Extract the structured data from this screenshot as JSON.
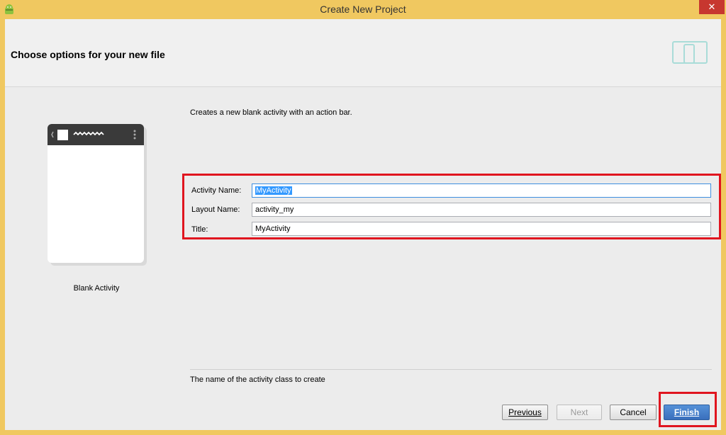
{
  "window": {
    "title": "Create New Project",
    "close_glyph": "✕"
  },
  "header": {
    "title": "Choose options for your new file",
    "icon": "device-preview-icon"
  },
  "template": {
    "name": "Blank Activity"
  },
  "description": "Creates a new blank activity with an action bar.",
  "form": {
    "fields": [
      {
        "label": "Activity Name:",
        "value": "MyActivity"
      },
      {
        "label": "Layout Name:",
        "value": "activity_my"
      },
      {
        "label": "Title:",
        "value": "MyActivity"
      }
    ]
  },
  "hint": "The name of the activity class to create",
  "buttons": {
    "previous": "Previous",
    "next": "Next",
    "cancel": "Cancel",
    "finish": "Finish"
  },
  "colors": {
    "highlight_border": "#e0151f",
    "primary_button": "#3a6fbd",
    "selection": "#3399ff"
  }
}
